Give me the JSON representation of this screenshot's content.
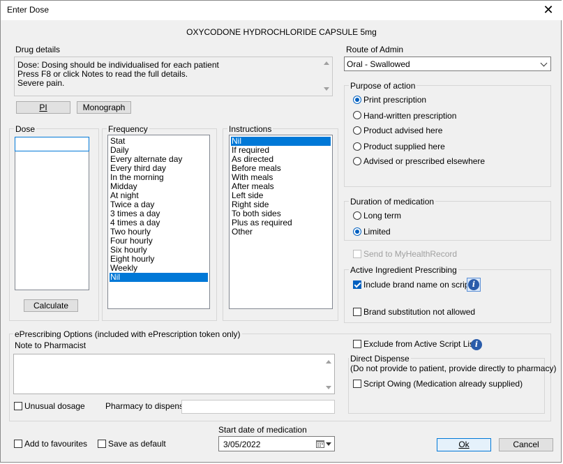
{
  "window": {
    "title": "Enter Dose",
    "close_glyph": "✕"
  },
  "drug_name": "OXYCODONE HYDROCHLORIDE CAPSULE 5mg",
  "drug_details": {
    "label": "Drug details",
    "lines": [
      "Dose: Dosing should be individualised for each patient",
      "Press F8 or click  Notes to read the full details.",
      "Severe  pain."
    ],
    "pi_button": "PI",
    "monograph_button": "Monograph"
  },
  "dose": {
    "label": "Dose",
    "value": "",
    "calculate_button": "Calculate"
  },
  "frequency": {
    "label": "Frequency",
    "items": [
      "Stat",
      "Daily",
      "Every alternate day",
      "Every third day",
      "In the morning",
      "Midday",
      "At night",
      "Twice a day",
      "3 times a day",
      "4 times a day",
      "Two hourly",
      "Four hourly",
      "Six hourly",
      "Eight hourly",
      "Weekly",
      "Nil"
    ],
    "selected": "Nil"
  },
  "instructions": {
    "label": "Instructions",
    "items": [
      "Nil",
      "If required",
      "As directed",
      "Before meals",
      "With meals",
      "After meals",
      "Left side",
      "Right side",
      "To both sides",
      "Plus as required",
      "Other"
    ],
    "selected": "Nil"
  },
  "route": {
    "label": "Route of Admin",
    "value": "Oral - Swallowed"
  },
  "purpose": {
    "label": "Purpose of action",
    "options": [
      "Print prescription",
      "Hand-written prescription",
      "Product advised here",
      "Product supplied here",
      "Advised or prescribed elsewhere"
    ],
    "selected": "Print prescription"
  },
  "duration": {
    "label": "Duration of medication",
    "options": [
      "Long term",
      "Limited"
    ],
    "selected": "Limited"
  },
  "send_mhr": {
    "label": "Send to MyHealthRecord",
    "checked": false,
    "disabled": true
  },
  "aip": {
    "label": "Active Ingredient Prescribing",
    "include_brand": {
      "label": "Include brand name on script",
      "checked": true
    },
    "brand_sub": {
      "label": "Brand substitution not allowed",
      "checked": false
    }
  },
  "eprescribing": {
    "label": "ePrescribing Options (included with ePrescription token only)",
    "note_label": "Note to Pharmacist",
    "note_value": "",
    "unusual_dosage": {
      "label": "Unusual dosage",
      "checked": false
    },
    "pharmacy_label": "Pharmacy to dispense",
    "pharmacy_value": "",
    "exclude_asl": {
      "label": "Exclude from Active Script List",
      "checked": false
    },
    "direct_dispense": {
      "label": "Direct Dispense",
      "subtitle": "(Do not provide to patient, provide directly to pharmacy)",
      "script_owing": {
        "label": "Script Owing (Medication already supplied)",
        "checked": false
      }
    }
  },
  "footer": {
    "add_fav": {
      "label": "Add to favourites",
      "checked": false
    },
    "save_default": {
      "label": "Save as default",
      "checked": false
    },
    "start_date_label": "Start date of medication",
    "start_date": "3/05/2022",
    "ok_button": "Ok",
    "cancel_button": "Cancel"
  },
  "colors": {
    "accent": "#0078d7",
    "selection": "#0078d7",
    "check_fill": "#0060c0",
    "info_icon": "#2a5caa"
  }
}
